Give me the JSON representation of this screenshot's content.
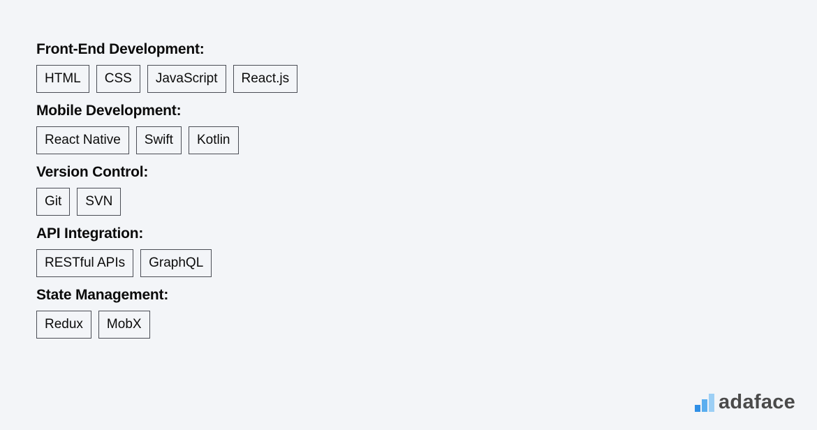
{
  "sections": [
    {
      "heading": "Front-End Development:",
      "tags": [
        "HTML",
        "CSS",
        "JavaScript",
        "React.js"
      ]
    },
    {
      "heading": "Mobile Development:",
      "tags": [
        "React Native",
        "Swift",
        "Kotlin"
      ]
    },
    {
      "heading": "Version Control:",
      "tags": [
        "Git",
        "SVN"
      ]
    },
    {
      "heading": "API Integration:",
      "tags": [
        "RESTful APIs",
        "GraphQL"
      ]
    },
    {
      "heading": "State Management:",
      "tags": [
        "Redux",
        "MobX"
      ]
    }
  ],
  "logo": {
    "text": "adaface",
    "icon": "bar-chart-icon",
    "colors": [
      "#2f8fe6",
      "#5aaeef",
      "#9ccff5"
    ]
  }
}
